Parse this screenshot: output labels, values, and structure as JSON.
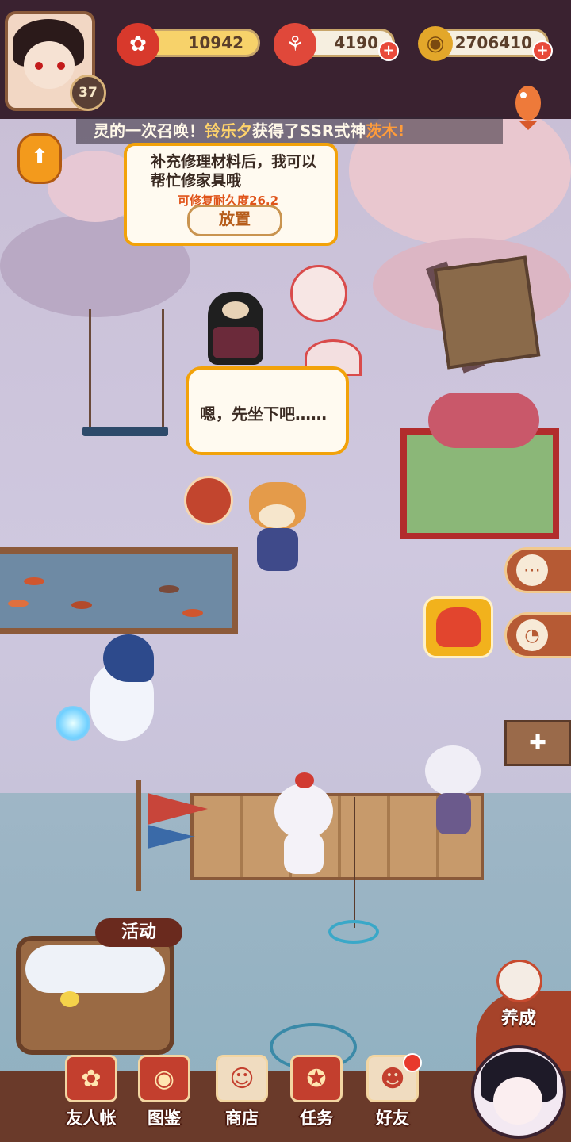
{
  "player": {
    "level": "37"
  },
  "resources": [
    {
      "name": "stamina",
      "value": "10942",
      "icon": "plum-blossom-icon",
      "has_plus": false
    },
    {
      "name": "magatama",
      "value": "4190",
      "icon": "magatama-icon",
      "has_plus": true
    },
    {
      "name": "coins",
      "value": "2706410",
      "icon": "coin-icon",
      "has_plus": true
    }
  ],
  "announcement": {
    "prefix": "灵的一次召唤！",
    "player_name": "铃乐夕",
    "mid": "获得了SSR式神",
    "shikigami": "茨木!"
  },
  "repair_bubble": {
    "text": "补充修理材料后，我可以帮忙修家具哦",
    "durability": "可修复耐久度26.2",
    "button": "放置"
  },
  "speech_bubble": {
    "text": "嗯，先坐下吧……"
  },
  "event_label": "活动",
  "develop_label": "养成",
  "nav": [
    {
      "label": "友人帐",
      "icon": "notebook-icon"
    },
    {
      "label": "图鉴",
      "icon": "eye-book-icon"
    },
    {
      "label": "商店",
      "icon": "cat-shop-icon"
    },
    {
      "label": "任务",
      "icon": "task-icon"
    },
    {
      "label": "好友",
      "icon": "friends-icon"
    }
  ],
  "colors": {
    "accent": "#f2a20a",
    "brand": "#c33f2e",
    "highlight": "#ffd36b"
  }
}
